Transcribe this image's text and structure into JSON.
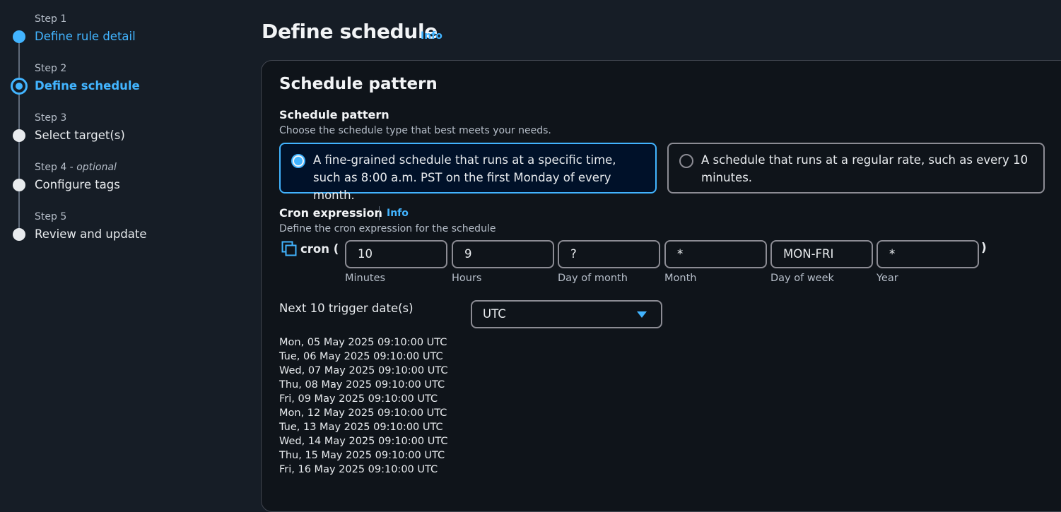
{
  "wizard": {
    "steps": [
      {
        "number": "Step 1",
        "title": "Define rule detail",
        "state": "done"
      },
      {
        "number": "Step 2",
        "title": "Define schedule",
        "state": "current"
      },
      {
        "number": "Step 3",
        "title": "Select target(s)",
        "state": "upcoming"
      },
      {
        "number": "Step 4",
        "optional": "optional",
        "title": "Configure tags",
        "state": "upcoming"
      },
      {
        "number": "Step 5",
        "title": "Review and update",
        "state": "upcoming"
      }
    ]
  },
  "header": {
    "title": "Define schedule",
    "info": "Info"
  },
  "schedule": {
    "section_title": "Schedule pattern",
    "pattern_label": "Schedule pattern",
    "pattern_desc": "Choose the schedule type that best meets your needs.",
    "options": [
      {
        "text": "A fine-grained schedule that runs at a specific time, such as 8:00 a.m. PST on the first Monday of every month.",
        "selected": true
      },
      {
        "text": "A schedule that runs at a regular rate, such as every 10 minutes.",
        "selected": false
      }
    ],
    "cron_label": "Cron expression",
    "cron_info": "Info",
    "cron_desc": "Define the cron expression for the schedule",
    "cron_prefix": "cron (",
    "cron_suffix": ")",
    "fields": [
      {
        "value": "10",
        "label": "Minutes"
      },
      {
        "value": "9",
        "label": "Hours"
      },
      {
        "value": "?",
        "label": "Day of month"
      },
      {
        "value": "*",
        "label": "Month"
      },
      {
        "value": "MON-FRI",
        "label": "Day of week"
      },
      {
        "value": "*",
        "label": "Year"
      }
    ],
    "next_label": "Next 10 trigger date(s)",
    "timezone": "UTC",
    "dates": [
      "Mon, 05 May 2025 09:10:00 UTC",
      "Tue, 06 May 2025 09:10:00 UTC",
      "Wed, 07 May 2025 09:10:00 UTC",
      "Thu, 08 May 2025 09:10:00 UTC",
      "Fri, 09 May 2025 09:10:00 UTC",
      "Mon, 12 May 2025 09:10:00 UTC",
      "Tue, 13 May 2025 09:10:00 UTC",
      "Wed, 14 May 2025 09:10:00 UTC",
      "Thu, 15 May 2025 09:10:00 UTC",
      "Fri, 16 May 2025 09:10:00 UTC"
    ]
  },
  "colors": {
    "accent": "#42b4ff",
    "background": "#161d26",
    "panel": "#0f141a"
  }
}
